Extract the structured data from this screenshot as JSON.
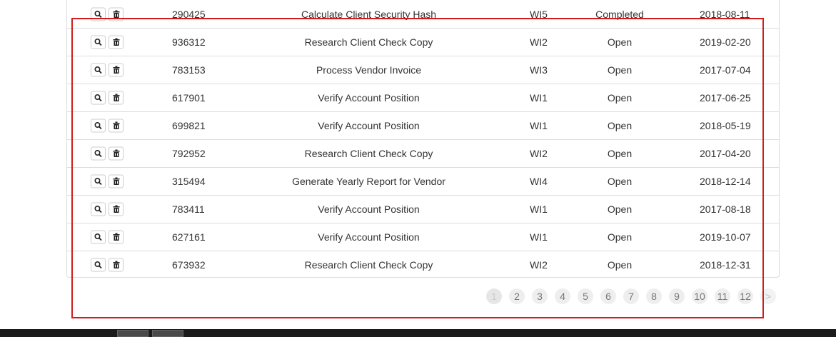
{
  "table": {
    "rows": [
      {
        "id": "290425",
        "description": "Calculate Client Security Hash",
        "wi": "WI5",
        "status": "Completed",
        "date": "2018-08-11"
      },
      {
        "id": "936312",
        "description": "Research Client Check Copy",
        "wi": "WI2",
        "status": "Open",
        "date": "2019-02-20"
      },
      {
        "id": "783153",
        "description": "Process Vendor Invoice",
        "wi": "WI3",
        "status": "Open",
        "date": "2017-07-04"
      },
      {
        "id": "617901",
        "description": "Verify Account Position",
        "wi": "WI1",
        "status": "Open",
        "date": "2017-06-25"
      },
      {
        "id": "699821",
        "description": "Verify Account Position",
        "wi": "WI1",
        "status": "Open",
        "date": "2018-05-19"
      },
      {
        "id": "792952",
        "description": "Research Client Check Copy",
        "wi": "WI2",
        "status": "Open",
        "date": "2017-04-20"
      },
      {
        "id": "315494",
        "description": "Generate Yearly Report for Vendor",
        "wi": "WI4",
        "status": "Open",
        "date": "2018-12-14"
      },
      {
        "id": "783411",
        "description": "Verify Account Position",
        "wi": "WI1",
        "status": "Open",
        "date": "2017-08-18"
      },
      {
        "id": "627161",
        "description": "Verify Account Position",
        "wi": "WI1",
        "status": "Open",
        "date": "2019-10-07"
      },
      {
        "id": "673932",
        "description": "Research Client Check Copy",
        "wi": "WI2",
        "status": "Open",
        "date": "2018-12-31"
      }
    ],
    "row_actions": [
      {
        "name": "view-button",
        "icon": "search-icon"
      },
      {
        "name": "delete-button",
        "icon": "trash-icon"
      }
    ]
  },
  "pagination": {
    "pages": [
      "1",
      "2",
      "3",
      "4",
      "5",
      "6",
      "7",
      "8",
      "9",
      "10",
      "11",
      "12"
    ],
    "current": "1",
    "next_label": ">"
  },
  "colors": {
    "highlight_border": "#d01c1c",
    "taskbar": "#1b1b1b"
  }
}
